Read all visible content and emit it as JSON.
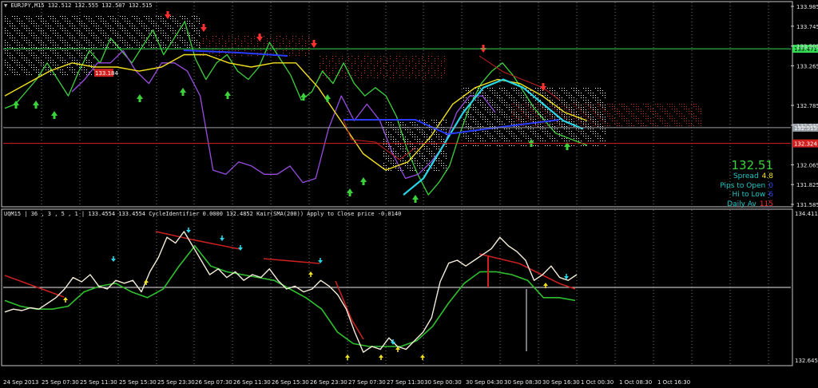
{
  "main_header": {
    "symbol": "EURJPY,M15",
    "ohlc": "132.512 132.555 132.507 132.515"
  },
  "sub_header": {
    "text": "UQM15 | 36 , 3 , 5 , 1 | 133.4554 133.4554 CycleIdentifier 0.0000 132.4852 Kair(SMA(200)) Apply to Close price -0.0140"
  },
  "info_panel": {
    "price": "132.51",
    "rows": [
      {
        "label": "Spread",
        "value": "4.8",
        "color": "#f2e020"
      },
      {
        "label": "Pips to Open",
        "value": "0",
        "color": "#2a4cff"
      },
      {
        "label": "Hi to Low",
        "value": "6",
        "color": "#2a4cff"
      },
      {
        "label": "Daily Av",
        "value": "115",
        "color": "#ff2a2a"
      }
    ]
  },
  "price_labels": {
    "level_green": "133.471",
    "level_current": "132.515",
    "level_red": "132.324",
    "left_marker": "133.184"
  },
  "colors": {
    "background": "#000000",
    "grid": "#c8c8c8",
    "candles": "#3cd23c",
    "purple_line": "#9a4ce0",
    "yellow_ma": "#f2e020",
    "cyan_ma": "#29d6e6",
    "ichimoku_dots": "#ffffff",
    "cloud_red": "#c83232",
    "up_arrow": "#3cd23c",
    "down_arrow": "#ff3030",
    "osc_line": "#f4ecd8",
    "signal_green": "#2fc02f",
    "signal_red": "#c82020"
  },
  "chart_data": [
    {
      "type": "line",
      "title": "EURJPY,M15",
      "y_ticks": [
        "133.985",
        "133.745",
        "133.505",
        "133.265",
        "132.785",
        "132.545",
        "132.065",
        "131.825",
        "131.585"
      ],
      "ylim": [
        131.585,
        133.985
      ],
      "horizontal_levels": [
        133.471,
        132.515,
        132.324
      ],
      "series": [
        {
          "values": [
            132.75,
            132.8,
            132.95,
            133.1,
            133.3,
            133.1,
            132.9,
            133.2,
            133.45,
            133.3,
            133.6,
            133.45,
            133.3,
            133.5,
            133.7,
            133.4,
            133.6,
            133.8,
            133.35,
            133.1,
            133.3,
            133.4,
            133.2,
            133.1,
            133.25,
            133.55,
            133.35,
            133.15,
            132.85,
            132.95,
            133.2,
            133.05,
            133.3,
            133.05,
            132.9,
            133.0,
            132.9,
            132.65,
            132.25,
            131.95,
            131.7,
            131.85,
            132.05,
            132.45,
            132.8,
            133.05,
            133.2,
            133.3,
            133.15,
            132.95,
            132.75,
            132.6,
            132.45,
            132.4,
            132.35,
            132.3
          ]
        },
        {
          "values": [
            132.95,
            133.1,
            133.3,
            133.3,
            133.45,
            133.2,
            133.05,
            133.3,
            133.3,
            133.2,
            132.9,
            132.0,
            131.95,
            132.1,
            132.05,
            131.95,
            131.95,
            132.05,
            131.85,
            131.9,
            132.5,
            132.9,
            132.6,
            132.8,
            132.6,
            132.2,
            131.9,
            131.95,
            132.1,
            132.3,
            132.7,
            132.9,
            132.9,
            132.7
          ]
        },
        {
          "values": [
            132.9,
            133.05,
            133.2,
            133.3,
            133.25,
            133.25,
            133.2,
            133.25,
            133.4,
            133.4,
            133.3,
            133.25,
            133.3,
            133.3,
            133.0,
            132.6,
            132.2,
            132.0,
            132.1,
            132.4,
            132.8,
            133.0,
            133.1,
            133.05,
            132.9,
            132.7,
            132.6
          ]
        },
        {
          "values": [
            131.7,
            131.9,
            132.3,
            132.7,
            133.0,
            133.1,
            133.0,
            132.8,
            132.6,
            132.5
          ]
        }
      ]
    },
    {
      "type": "line",
      "title": "UQM15",
      "y_ticks": [
        "134.4119",
        "132.6457"
      ],
      "x_ticks": [
        "24 Sep 2013",
        "25 Sep 07:30",
        "25 Sep 11:30",
        "25 Sep 15:30",
        "25 Sep 23:30",
        "26 Sep 07:30",
        "26 Sep 11:30",
        "26 Sep 15:30",
        "26 Sep 23:30",
        "27 Sep 07:30",
        "27 Sep 11:30",
        "30 Sep 00:30",
        "30 Sep 04:30",
        "30 Sep 08:30",
        "30 Sep 16:30",
        "1 Oct 00:30",
        "1 Oct 08:30",
        "1 Oct 16:30"
      ],
      "series": [
        {
          "values": [
            0.34,
            0.36,
            0.35,
            0.37,
            0.36,
            0.4,
            0.44,
            0.5,
            0.58,
            0.55,
            0.6,
            0.52,
            0.5,
            0.56,
            0.54,
            0.56,
            0.48,
            0.62,
            0.72,
            0.86,
            0.82,
            0.9,
            0.8,
            0.7,
            0.6,
            0.64,
            0.58,
            0.62,
            0.56,
            0.6,
            0.58,
            0.64,
            0.56,
            0.5,
            0.52,
            0.48,
            0.5,
            0.56,
            0.52,
            0.46,
            0.36,
            0.2,
            0.06,
            0.1,
            0.08,
            0.16,
            0.1,
            0.08,
            0.14,
            0.2,
            0.3,
            0.55,
            0.68,
            0.7,
            0.66,
            0.7,
            0.74,
            0.78,
            0.86,
            0.8,
            0.76,
            0.7,
            0.56,
            0.6,
            0.66,
            0.58,
            0.56,
            0.6
          ]
        },
        {
          "values": [
            0.42,
            0.38,
            0.36,
            0.36,
            0.38,
            0.48,
            0.52,
            0.54,
            0.48,
            0.44,
            0.5,
            0.66,
            0.8,
            0.66,
            0.62,
            0.6,
            0.58,
            0.56,
            0.5,
            0.44,
            0.36,
            0.2,
            0.12,
            0.1,
            0.1,
            0.1,
            0.14,
            0.24,
            0.4,
            0.54,
            0.62,
            0.62,
            0.6,
            0.56,
            0.44,
            0.44,
            0.42
          ]
        }
      ]
    }
  ]
}
